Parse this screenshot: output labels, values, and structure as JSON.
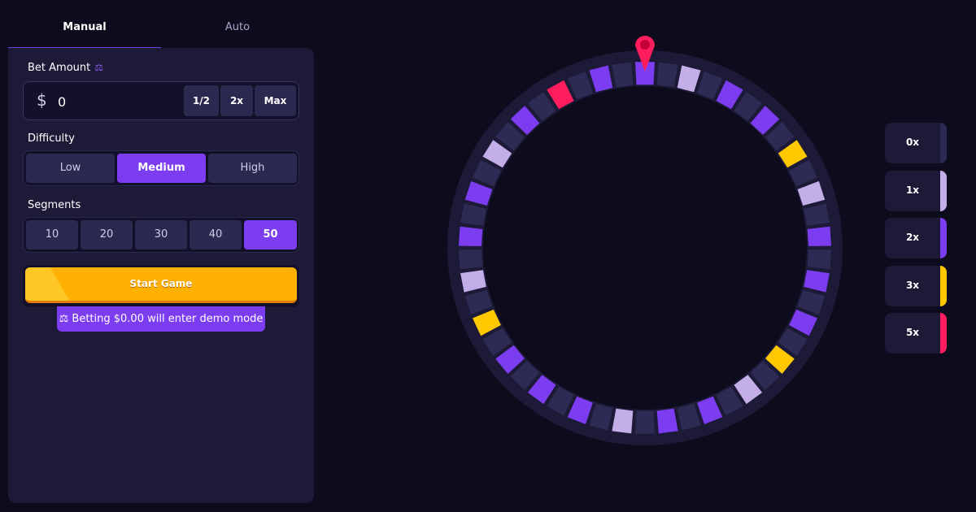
{
  "tabs": {
    "manual": "Manual",
    "auto": "Auto"
  },
  "bet": {
    "label": "Bet Amount",
    "label_icon": "joystick-icon",
    "currency": "$",
    "value": "0",
    "half": "1/2",
    "double": "2x",
    "max": "Max"
  },
  "difficulty": {
    "label": "Difficulty",
    "options": [
      "Low",
      "Medium",
      "High"
    ],
    "selected": "Medium"
  },
  "segments": {
    "label": "Segments",
    "options": [
      "10",
      "20",
      "30",
      "40",
      "50"
    ],
    "selected": "50"
  },
  "start_label": "Start Game",
  "demo_notice": "Betting $0.00 will enter demo mode",
  "colors": {
    "accent": "#7c3cf0",
    "dark_segment": "#2d2a54",
    "light_segment": "#c3aee8",
    "gold": "#ffc800",
    "red": "#ff1d5e",
    "start_button": "#ffb000"
  },
  "wheel": {
    "segment_count": 50,
    "pattern": [
      "purple",
      "dark",
      "light",
      "dark",
      "purple",
      "dark",
      "purple",
      "dark",
      "gold",
      "dark",
      "light",
      "dark",
      "purple",
      "dark",
      "purple",
      "dark",
      "purple",
      "dark",
      "gold",
      "dark",
      "light",
      "dark",
      "purple",
      "dark",
      "purple",
      "dark",
      "light",
      "dark",
      "purple",
      "dark",
      "purple",
      "dark",
      "purple",
      "dark",
      "gold",
      "dark",
      "light",
      "dark",
      "purple",
      "dark",
      "purple",
      "dark",
      "light",
      "dark",
      "purple",
      "dark",
      "red",
      "dark",
      "purple",
      "dark"
    ]
  },
  "multipliers": [
    {
      "label": "0x",
      "color": "#2d2a54"
    },
    {
      "label": "1x",
      "color": "#c3aee8"
    },
    {
      "label": "2x",
      "color": "#7c3cf0"
    },
    {
      "label": "3x",
      "color": "#ffc800"
    },
    {
      "label": "5x",
      "color": "#ff1d5e"
    }
  ]
}
